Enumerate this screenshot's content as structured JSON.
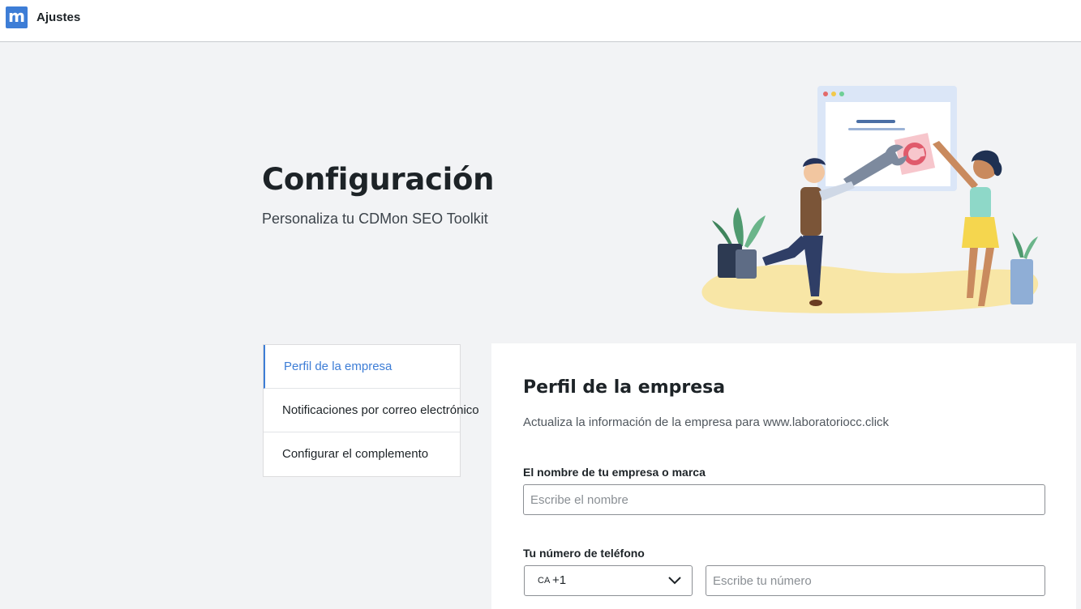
{
  "app": {
    "logo_letter": "m",
    "title": "Ajustes"
  },
  "hero": {
    "title": "Configuración",
    "subtitle": "Personaliza tu CDMon SEO Toolkit"
  },
  "sidenav": {
    "items": [
      {
        "label": "Perfil de la empresa",
        "active": true
      },
      {
        "label": "Notificaciones por correo electrónico",
        "active": false
      },
      {
        "label": "Configurar el complemento",
        "active": false
      }
    ]
  },
  "panel": {
    "title": "Perfil de la empresa",
    "subtitle": "Actualiza la información de la empresa para www.laboratoriocc.click",
    "company_field": {
      "label": "El nombre de tu empresa o marca",
      "placeholder": "Escribe el nombre",
      "value": ""
    },
    "phone_field": {
      "label": "Tu número de teléfono",
      "country_code": "CA",
      "dial_code": "+1",
      "placeholder": "Escribe tu número",
      "value": ""
    }
  },
  "colors": {
    "accent": "#3d7dd6",
    "background": "#f2f3f5"
  },
  "icons": {
    "logo": "m-logo-icon",
    "dropdown": "chevron-down-icon",
    "illustration": "settings-illustration"
  }
}
